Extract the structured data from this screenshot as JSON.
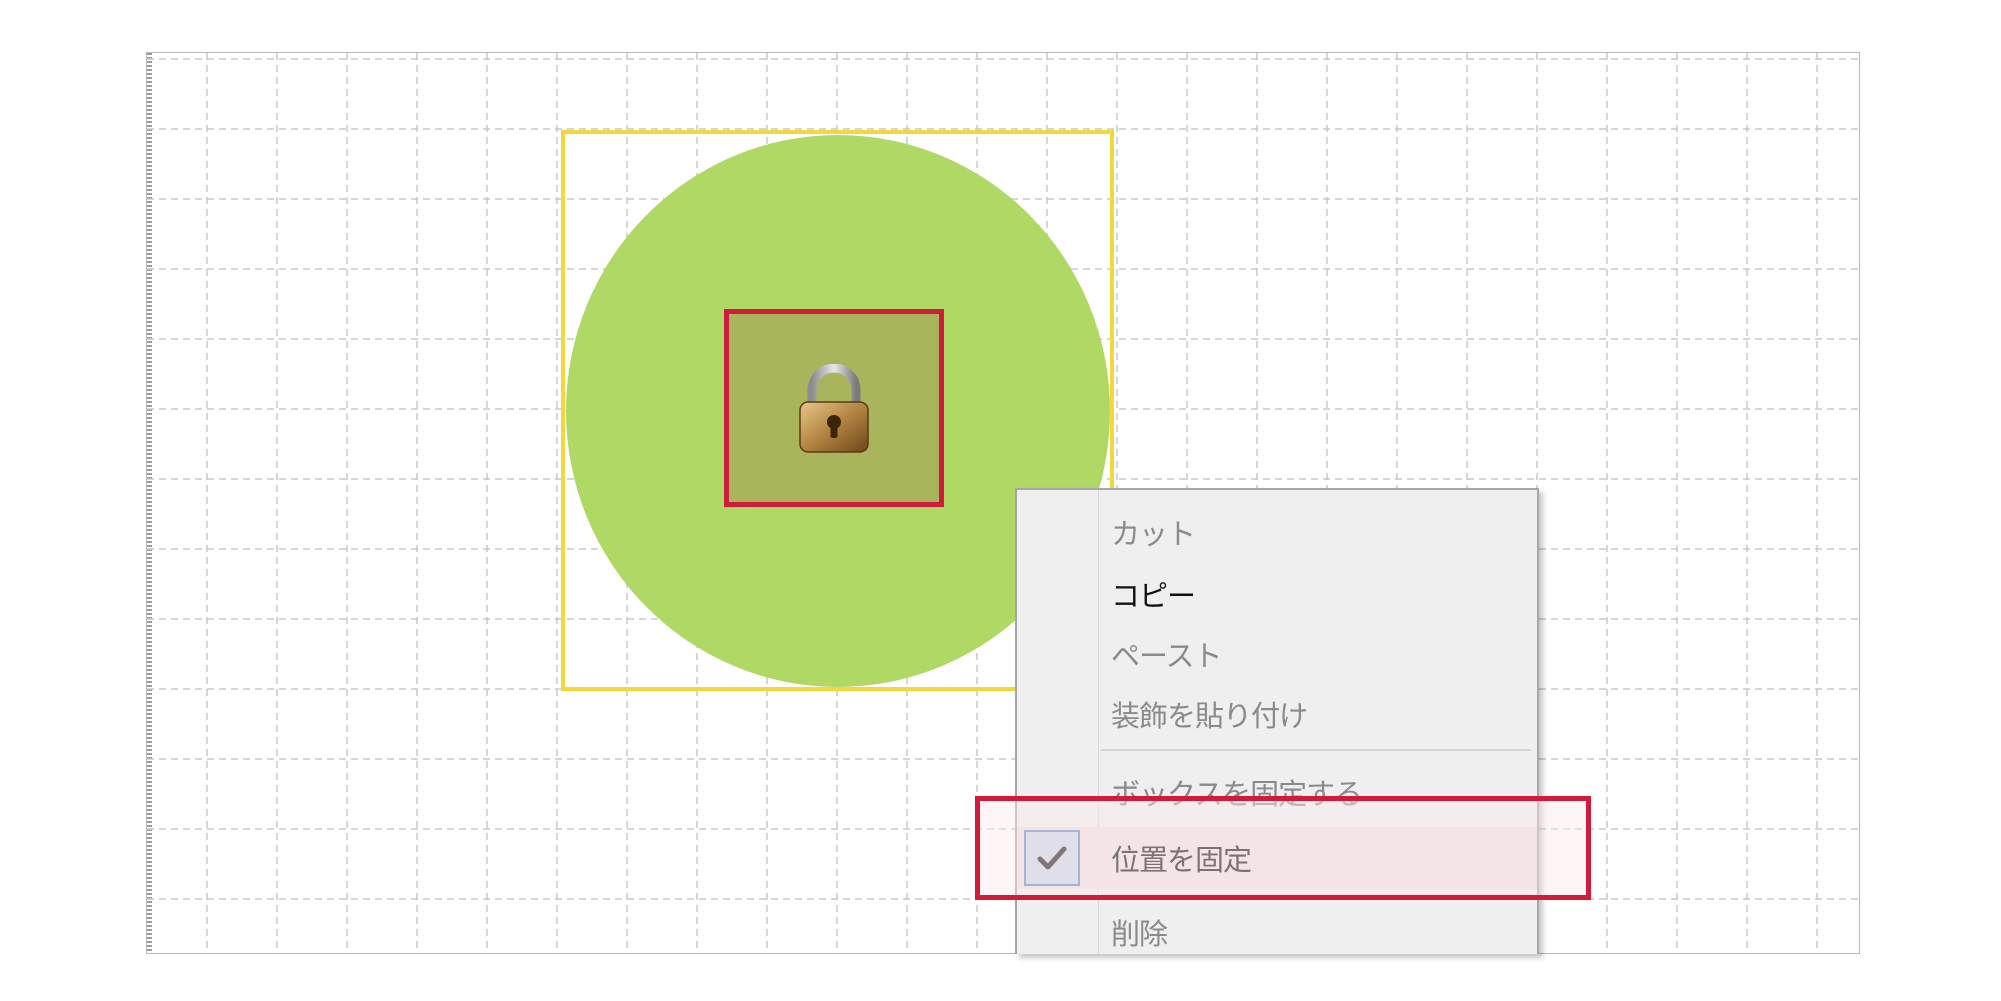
{
  "canvas": {
    "grid_color": "#c8c8c8"
  },
  "shape": {
    "fill_color": "#afd865",
    "frame_color": "#f3d73c",
    "lock_icon": "padlock-icon",
    "lock_highlight_color": "#cf1b3c"
  },
  "context_menu": {
    "items": [
      {
        "label": "カット",
        "state": "disabled"
      },
      {
        "label": "コピー",
        "state": "enabled"
      },
      {
        "label": "ペースト",
        "state": "disabled"
      },
      {
        "label": "装飾を貼り付け",
        "state": "disabled"
      },
      {
        "label": "ボックスを固定する",
        "state": "disabled"
      },
      {
        "label": "位置を固定",
        "state": "enabled",
        "checked": true,
        "check_icon": "checkmark-icon"
      },
      {
        "label": "削除",
        "state": "disabled"
      }
    ],
    "highlight_color": "#cf1b3c"
  }
}
